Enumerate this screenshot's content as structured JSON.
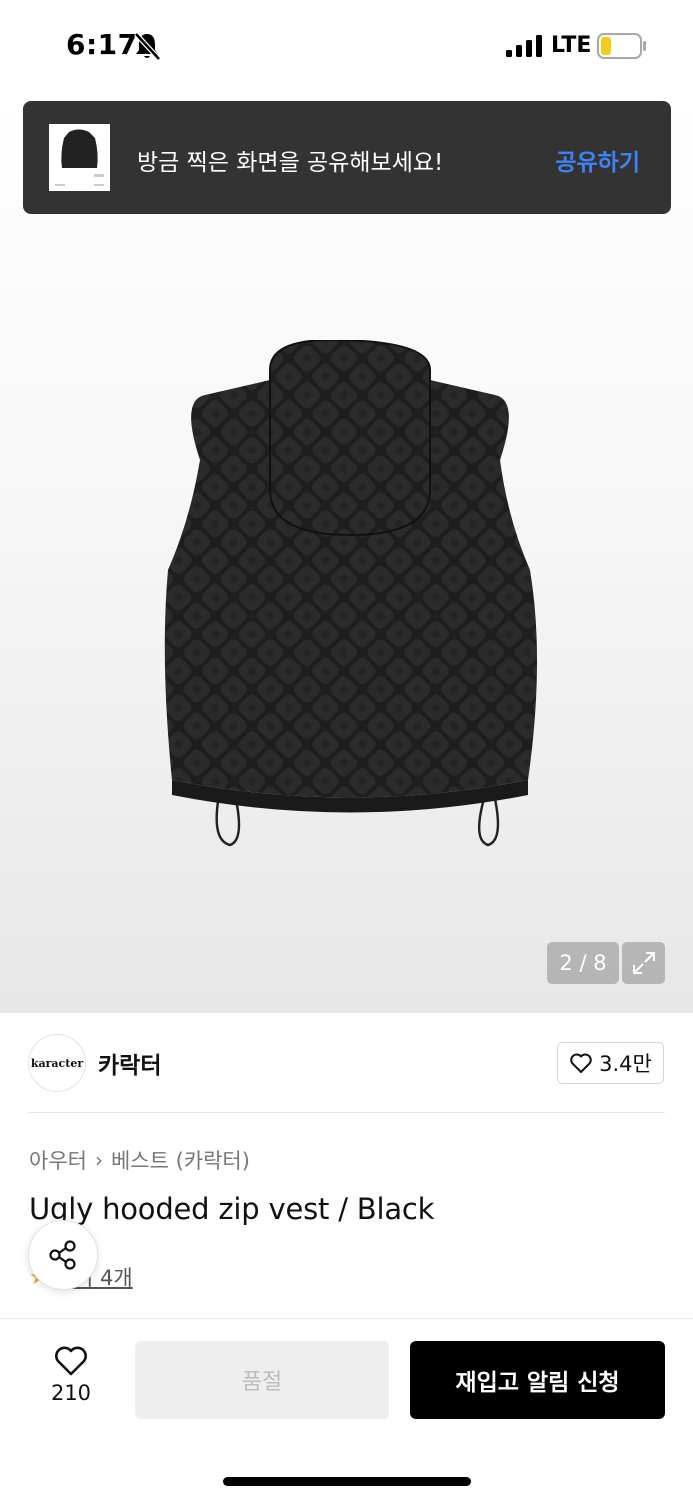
{
  "status_bar": {
    "time": "6:17",
    "network": "LTE",
    "icons": [
      "bell-slash-icon",
      "signal-icon",
      "battery-low-icon"
    ]
  },
  "toast": {
    "message": "방금 찍은 화면을 공유해보세요!",
    "action": "공유하기",
    "action_color": "#3d83f7"
  },
  "gallery": {
    "counter": "2 / 8",
    "icons": [
      "expand-icon"
    ]
  },
  "brand": {
    "logo_text": "karacter",
    "name": "카락터",
    "likes": "3.4만"
  },
  "product": {
    "breadcrumb": [
      "아우터",
      "베스트 (카락터)"
    ],
    "title": "Ugly hooded zip vest / Black",
    "review_text": "후기 4개"
  },
  "bottom_bar": {
    "like_count": "210",
    "soldout_label": "품절",
    "restock_label": "재입고 알림 신청"
  }
}
